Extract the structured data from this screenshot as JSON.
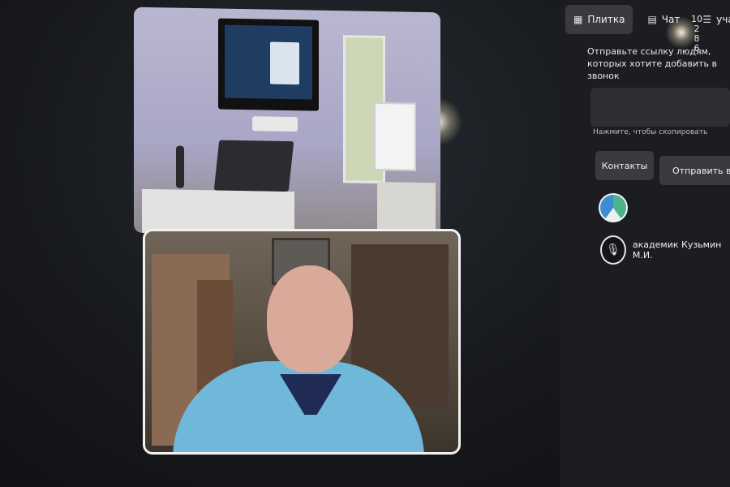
{
  "sidebar": {
    "tabs": [
      {
        "label": "Плитка",
        "icon": "grid-icon",
        "active": true
      },
      {
        "label": "Чат",
        "icon": "chat-icon",
        "active": false
      },
      {
        "label": "участни",
        "icon": "people-icon",
        "active": false
      }
    ],
    "counter": {
      "top": "10",
      "mid": "2",
      "low": "8",
      "bottom": "6"
    },
    "invite_text": "Отправьте ссылку людям, которых хотите добавить в звонок",
    "copy_hint": "Нажмите, чтобы скопировать",
    "contacts_button": "Контакты",
    "send_button": "Отправить в пис",
    "participants": [
      {
        "name": "",
        "avatar": "globe-avatar"
      },
      {
        "name": "академик Кузьмин М.И.",
        "avatar": "microphone-avatar"
      }
    ]
  },
  "video": {
    "tiles": [
      {
        "name": "conference-room-video"
      },
      {
        "name": "speaker-video"
      }
    ]
  },
  "colors": {
    "panel_bg": "#1c1d21",
    "button_bg": "#3a3b41",
    "active_tab_bg": "#3a3b40",
    "speaker_border": "#f2f2f2"
  }
}
